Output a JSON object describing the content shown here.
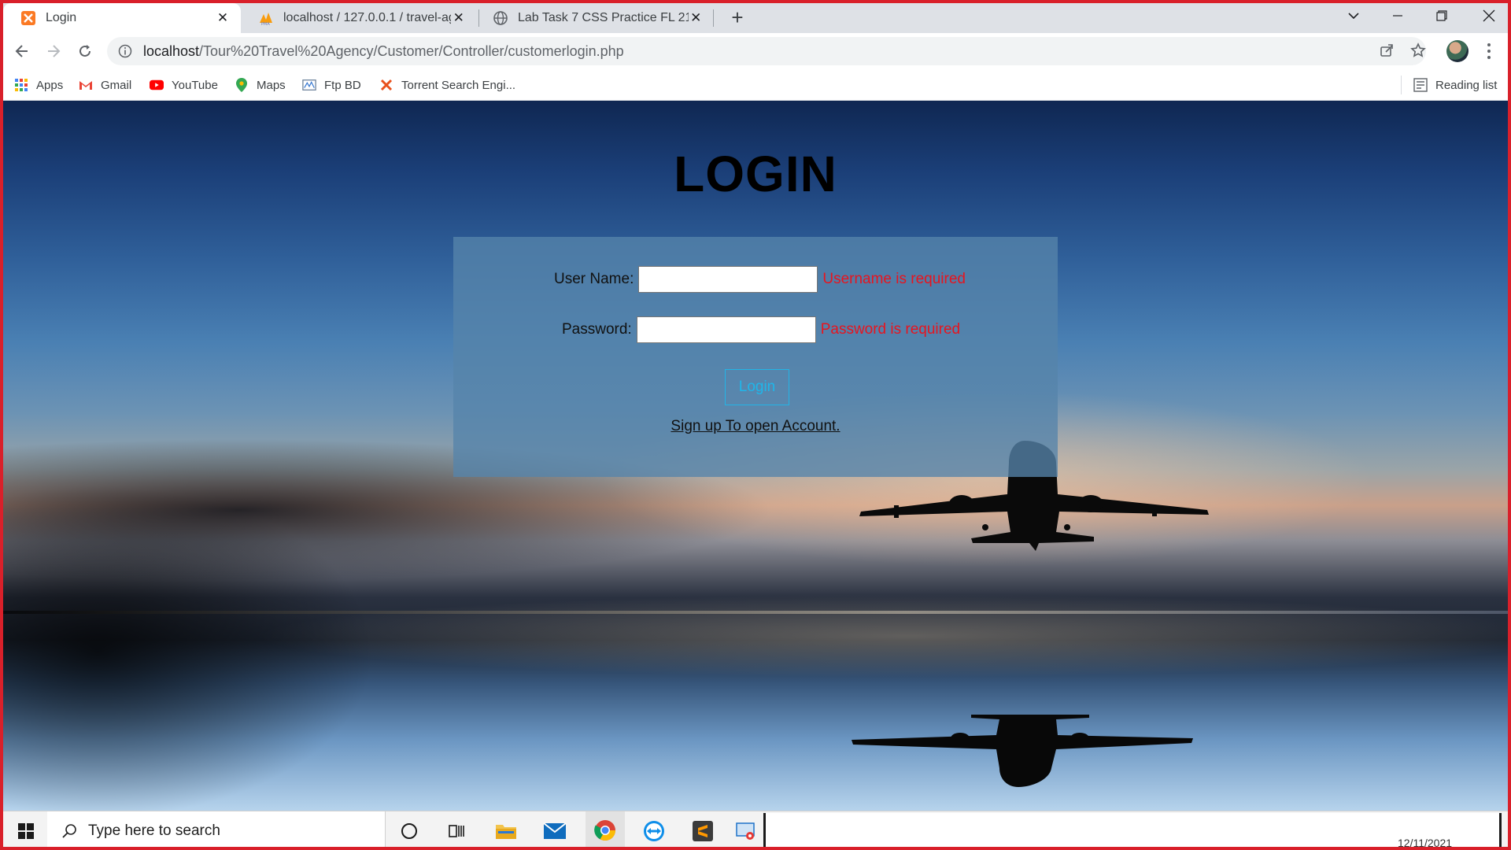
{
  "browser": {
    "tabs": [
      {
        "title": "Login",
        "active": true,
        "icon": "xampp-icon"
      },
      {
        "title": "localhost / 127.0.0.1 / travel-agency",
        "active": false,
        "icon": "phpmyadmin-icon"
      },
      {
        "title": "Lab Task 7 CSS Practice FL 21-22",
        "active": false,
        "icon": "globe-icon"
      }
    ],
    "address": {
      "host": "localhost",
      "path": "/Tour%20Travel%20Agency/Customer/Controller/customerlogin.php"
    },
    "bookmarks": [
      {
        "label": "Apps",
        "icon": "apps-grid-icon"
      },
      {
        "label": "Gmail",
        "icon": "gmail-icon"
      },
      {
        "label": "YouTube",
        "icon": "youtube-icon"
      },
      {
        "label": "Maps",
        "icon": "maps-pin-icon"
      },
      {
        "label": "Ftp BD",
        "icon": "ftp-icon"
      },
      {
        "label": "Torrent Search Engi...",
        "icon": "torrent-x-icon"
      }
    ],
    "reading_list": "Reading list"
  },
  "page": {
    "heading": "LOGIN",
    "username": {
      "label": "User Name:",
      "value": "",
      "error": "Username is required"
    },
    "password": {
      "label": "Password:",
      "value": "",
      "error": "Password is required"
    },
    "login_button": "Login",
    "signup_link": "Sign up To open Account."
  },
  "taskbar": {
    "search_placeholder": "Type here to search",
    "clock_fragment": "12/11/2021"
  },
  "colors": {
    "error": "#e8141e",
    "button_accent": "#1fb6ea",
    "form_panel": "#5684aa",
    "frame_border": "#d9202a"
  }
}
